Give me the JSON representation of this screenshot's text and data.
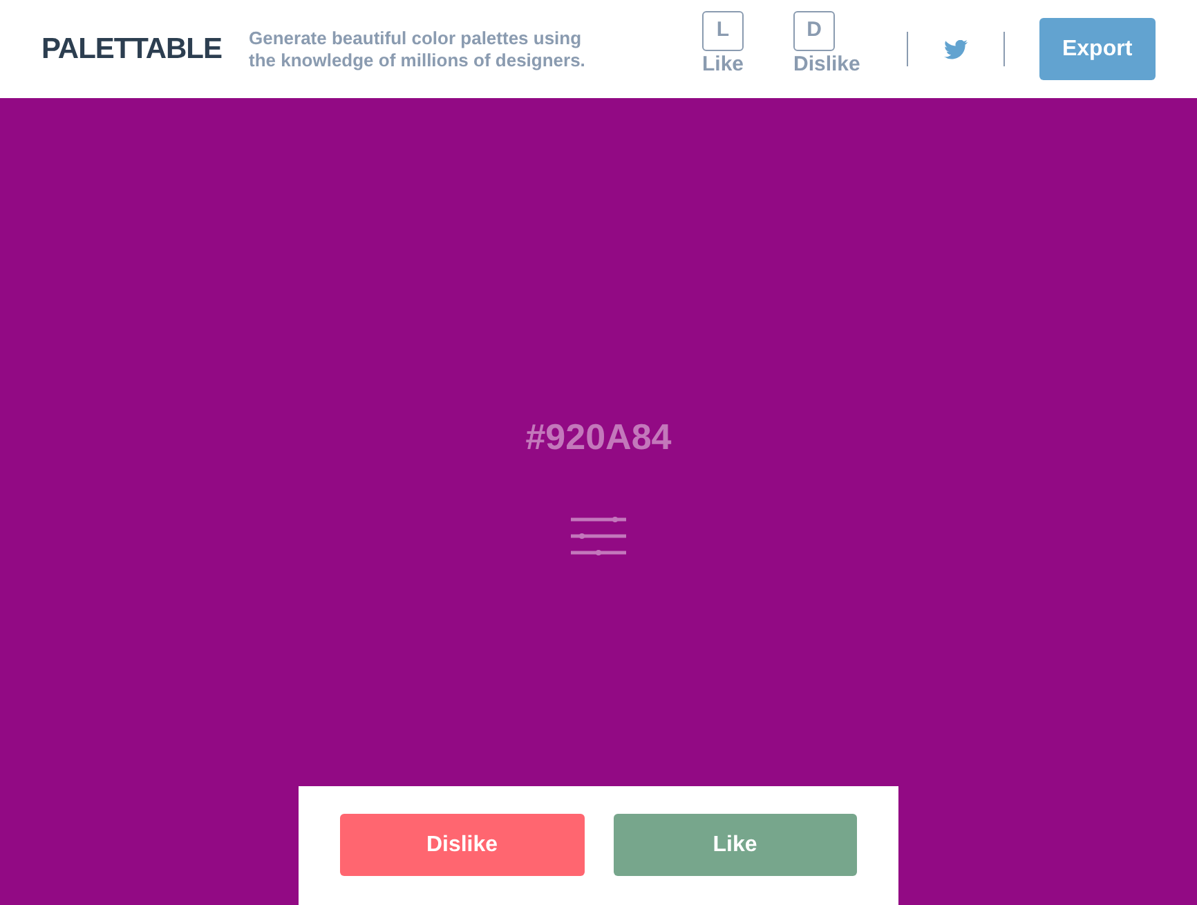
{
  "header": {
    "logo": "PALETTABLE",
    "tagline": "Generate beautiful color palettes using\nthe knowledge of millions of designers.",
    "shortcuts": [
      {
        "key": "L",
        "label": "Like"
      },
      {
        "key": "D",
        "label": "Dislike"
      }
    ],
    "export_button": "Export"
  },
  "swatch": {
    "color": "#920a84",
    "hex": "#920A84"
  },
  "vote_buttons": [
    {
      "kind": "dislike",
      "label": "Dislike"
    },
    {
      "kind": "like",
      "label": "Like"
    }
  ]
}
